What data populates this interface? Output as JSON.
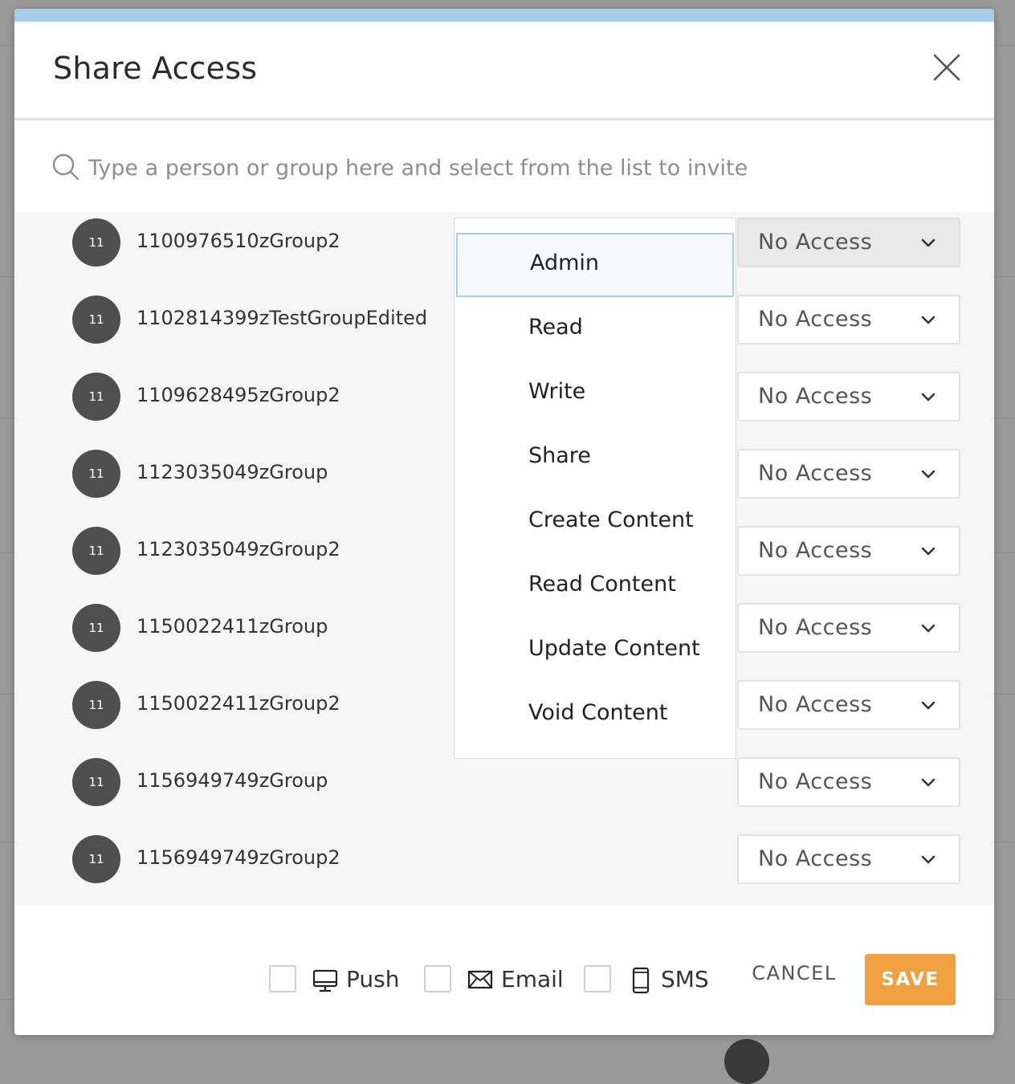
{
  "dialog": {
    "title": "Share Access",
    "close_icon": "close-icon"
  },
  "search": {
    "placeholder": "Type a person or group here and select from the list to invite",
    "value": ""
  },
  "groups": [
    {
      "avatar": "11",
      "name": "1100976510zGroup2",
      "access": "No Access"
    },
    {
      "avatar": "11",
      "name": "1102814399zTestGroupEdited",
      "access": "No Access"
    },
    {
      "avatar": "11",
      "name": "1109628495zGroup2",
      "access": "No Access"
    },
    {
      "avatar": "11",
      "name": "1123035049zGroup",
      "access": "No Access"
    },
    {
      "avatar": "11",
      "name": "1123035049zGroup2",
      "access": "No Access"
    },
    {
      "avatar": "11",
      "name": "1150022411zGroup",
      "access": "No Access"
    },
    {
      "avatar": "11",
      "name": "1150022411zGroup2",
      "access": "No Access"
    },
    {
      "avatar": "11",
      "name": "1156949749zGroup",
      "access": "No Access"
    },
    {
      "avatar": "11",
      "name": "1156949749zGroup2",
      "access": "No Access"
    }
  ],
  "access_menu": {
    "highlighted": "Admin",
    "options": [
      "Admin",
      "Read",
      "Write",
      "Share",
      "Create Content",
      "Read Content",
      "Update Content",
      "Void Content"
    ]
  },
  "notify": {
    "push_label": "Push",
    "email_label": "Email",
    "sms_label": "SMS",
    "push_checked": false,
    "email_checked": false,
    "sms_checked": false
  },
  "actions": {
    "cancel_label": "CANCEL",
    "save_label": "SAVE"
  },
  "colors": {
    "accent_bar": "#a8cdea",
    "save_button": "#f0a040",
    "avatar": "#4f4f4f"
  }
}
